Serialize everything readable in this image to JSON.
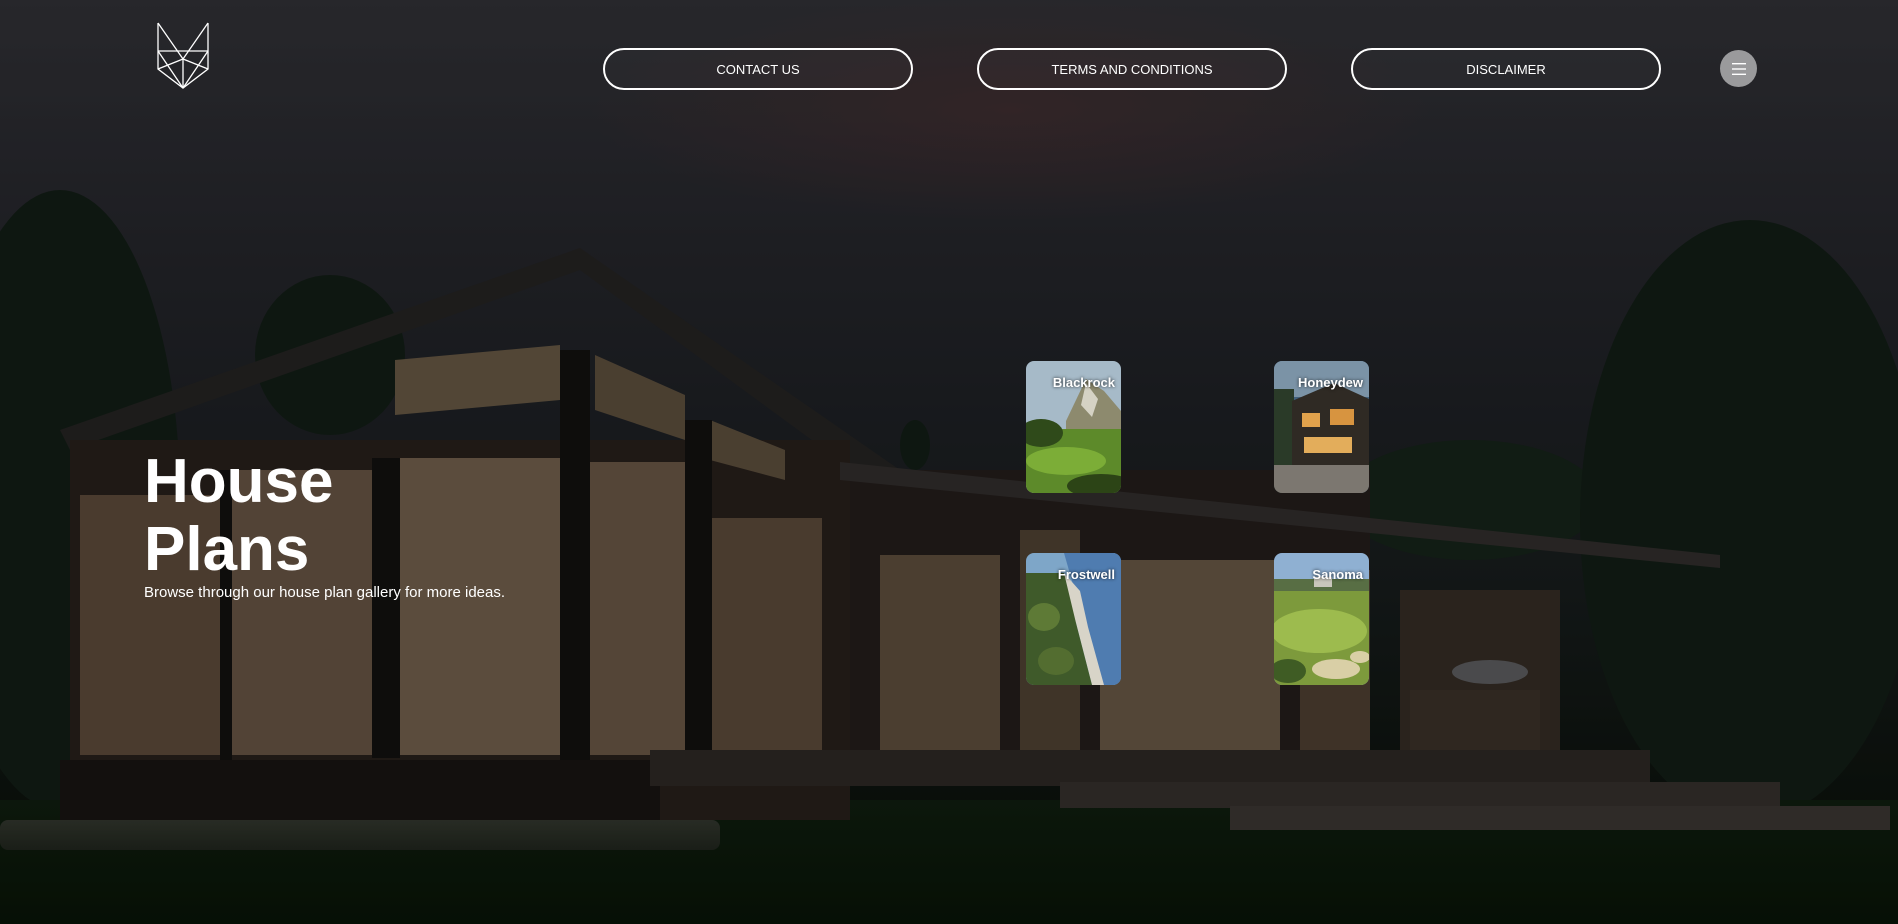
{
  "header": {
    "logo": "fox-logo",
    "nav": [
      {
        "label": "CONTACT US"
      },
      {
        "label": "TERMS AND CONDITIONS"
      },
      {
        "label": "DISCLAIMER"
      }
    ],
    "menu_icon": "hamburger-icon"
  },
  "hero": {
    "title_line1": "House",
    "title_line2": "Plans",
    "subtitle": "Browse through our house plan gallery for more ideas."
  },
  "gallery": [
    {
      "label": "Blackrock"
    },
    {
      "label": "Honeydew"
    },
    {
      "label": "Frostwell"
    },
    {
      "label": "Sanoma"
    }
  ],
  "colors": {
    "text": "#ffffff",
    "menu_button": "#9a9a9c"
  }
}
